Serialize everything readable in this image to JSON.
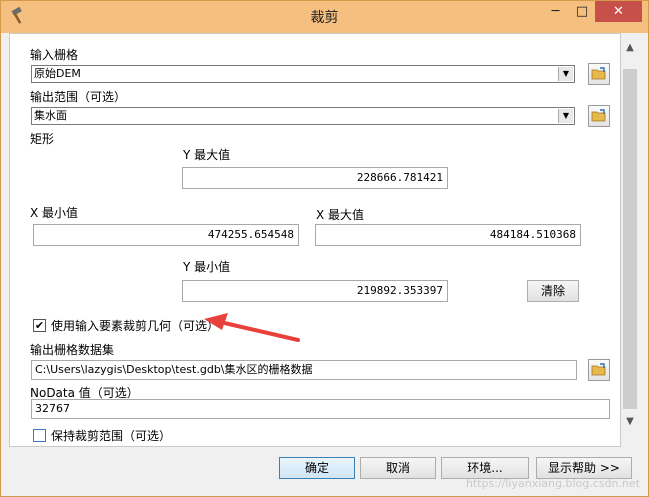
{
  "window": {
    "title": "裁剪"
  },
  "fields": {
    "input_raster": {
      "label": "输入栅格",
      "value": "原始DEM"
    },
    "output_extent": {
      "label": "输出范围（可选）",
      "value": "集水面"
    },
    "rectangle": {
      "label": "矩形"
    },
    "y_max": {
      "label": "Y 最大值",
      "value": "228666.781421"
    },
    "x_min": {
      "label": "X 最小值",
      "value": "474255.654548"
    },
    "x_max": {
      "label": "X 最大值",
      "value": "484184.510368"
    },
    "y_min": {
      "label": "Y 最小值",
      "value": "219892.353397"
    },
    "clear_label": "清除",
    "use_geometry": {
      "label": "使用输入要素裁剪几何（可选）",
      "checked": "✔"
    },
    "output_raster": {
      "label": "输出栅格数据集",
      "value": "C:\\Users\\lazygis\\Desktop\\test.gdb\\集水区的栅格数据"
    },
    "nodata": {
      "label": "NoData 值（可选）",
      "value": "32767"
    },
    "keep_extent": {
      "label": "保持裁剪范围（可选）"
    }
  },
  "buttons": {
    "ok": "确定",
    "cancel": "取消",
    "env": "环境...",
    "help": "显示帮助 >>"
  },
  "watermark": "https://liyanxiang.blog.csdn.net",
  "colors": {
    "title_bar": "#f4bf7f",
    "close_button": "#c7504a",
    "annotation_arrow": "#e8413c"
  }
}
